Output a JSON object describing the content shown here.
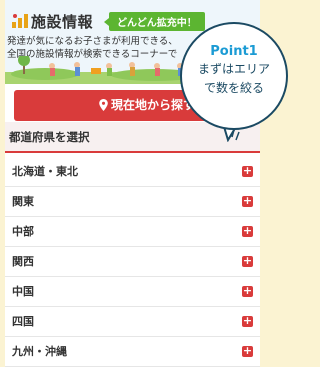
{
  "header": {
    "title": "施設情報",
    "badge": "どんどん拡充中！",
    "description_lines": [
      "発達が気になるお子さまが利用できる、",
      "全国の施設情報が検索できるコーナーで"
    ]
  },
  "location_button": {
    "label": "現在地から探す"
  },
  "prefecture_section": {
    "title": "都道府県を選択",
    "regions": [
      {
        "label": "北海道・東北"
      },
      {
        "label": "関東"
      },
      {
        "label": "中部"
      },
      {
        "label": "関西"
      },
      {
        "label": "中国"
      },
      {
        "label": "四国"
      },
      {
        "label": "九州・沖縄"
      }
    ],
    "expand_symbol": "+"
  },
  "callout": {
    "heading": "Point1",
    "line1": "まずはエリア",
    "line2": "で数を絞る"
  },
  "colors": {
    "accent_red": "#d93b3b",
    "badge_green": "#5cb531",
    "callout_blue": "#1b9bd4",
    "callout_border": "#1b4a63",
    "page_background": "#fbf3d2"
  }
}
